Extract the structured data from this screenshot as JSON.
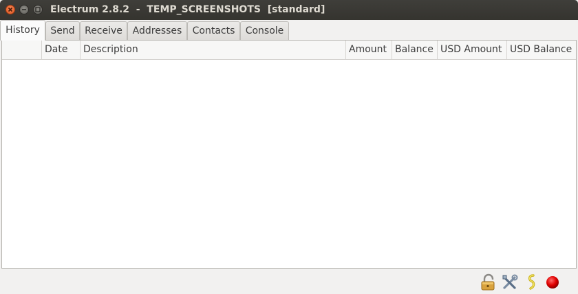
{
  "window": {
    "title": "Electrum 2.8.2  -  TEMP_SCREENSHOTS  [standard]"
  },
  "tabs": [
    {
      "label": "History",
      "active": true
    },
    {
      "label": "Send"
    },
    {
      "label": "Receive"
    },
    {
      "label": "Addresses"
    },
    {
      "label": "Contacts"
    },
    {
      "label": "Console"
    }
  ],
  "history_table": {
    "columns": [
      "",
      "Date",
      "Description",
      "Amount",
      "Balance",
      "USD Amount",
      "USD Balance"
    ],
    "rows": []
  },
  "status_bar": {
    "icons": [
      "lock-icon",
      "preferences-tools-icon",
      "seed-icon",
      "network-status-icon"
    ],
    "network_status_color": "#e00000"
  }
}
